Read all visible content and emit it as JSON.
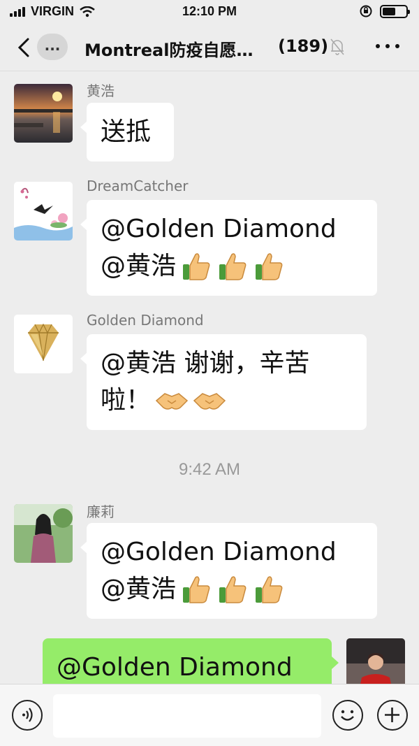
{
  "status_bar": {
    "carrier": "VIRGIN",
    "time": "12:10 PM"
  },
  "nav": {
    "back_icon": "chevron-left-icon",
    "more_pill_label": "...",
    "title": "Montreal防疫自愿…",
    "member_count": "(189)",
    "mute_icon": "bell-muted-icon",
    "menu_icon": "more-dots-icon"
  },
  "messages": [
    {
      "sender": "黄浩",
      "lines": [
        "送抵"
      ]
    },
    {
      "sender": "DreamCatcher",
      "lines": [
        "@Golden Diamond",
        "@黄浩"
      ],
      "emoji": [
        "thumbs-up",
        "thumbs-up",
        "thumbs-up"
      ]
    },
    {
      "sender": "Golden Diamond",
      "lines": [
        "@黄浩 谢谢，辛苦",
        "啦！"
      ],
      "emoji": [
        "handshake",
        "handshake"
      ]
    },
    {
      "sender": "廉莉",
      "lines": [
        "@Golden Diamond",
        "@黄浩"
      ],
      "emoji": [
        "thumbs-up",
        "thumbs-up",
        "thumbs-up"
      ]
    }
  ],
  "timestamp": "9:42 AM",
  "my_message": {
    "lines": [
      "@Golden Diamond"
    ]
  },
  "input_bar": {
    "voice_icon": "voice-icon",
    "input_value": "",
    "emoji_icon": "emoji-icon",
    "plus_icon": "plus-icon"
  }
}
